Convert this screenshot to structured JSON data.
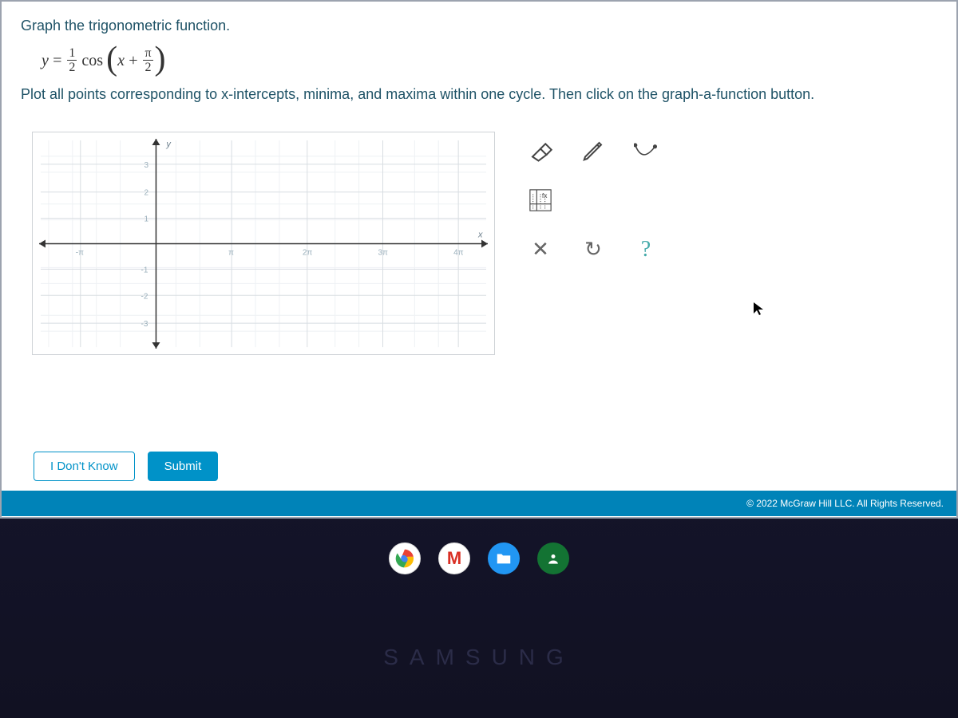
{
  "question": {
    "title": "Graph the trigonometric function.",
    "equation": {
      "lhs_var": "y",
      "eq": "=",
      "coef_num": "1",
      "coef_den": "2",
      "func": "cos",
      "inner_var": "x",
      "plus": "+",
      "shift_num": "π",
      "shift_den": "2"
    },
    "instruction": "Plot all points corresponding to x-intercepts, minima, and maxima within one cycle. Then click on the graph-a-function button."
  },
  "graph": {
    "x_axis_label": "x",
    "y_axis_label": "y",
    "y_ticks": [
      "3",
      "2",
      "1",
      "-1",
      "-2",
      "-3"
    ],
    "x_ticks_neg": [
      "-π"
    ],
    "x_ticks_pos": [
      "π",
      "2π",
      "3π",
      "4π"
    ]
  },
  "tools": {
    "eraser": "eraser-icon",
    "pen": "pen-icon",
    "curve": "curve-icon",
    "graph_fn": "graph-function-icon",
    "clear": "clear-icon",
    "reset": "reset-icon",
    "help": "help-icon",
    "help_glyph": "?",
    "clear_glyph": "✕",
    "reset_glyph": "↻"
  },
  "buttons": {
    "idk": "I Don't Know",
    "submit": "Submit"
  },
  "footer": {
    "copyright": "© 2022 McGraw Hill LLC. All Rights Reserved."
  },
  "brand": "SAMSUNG"
}
